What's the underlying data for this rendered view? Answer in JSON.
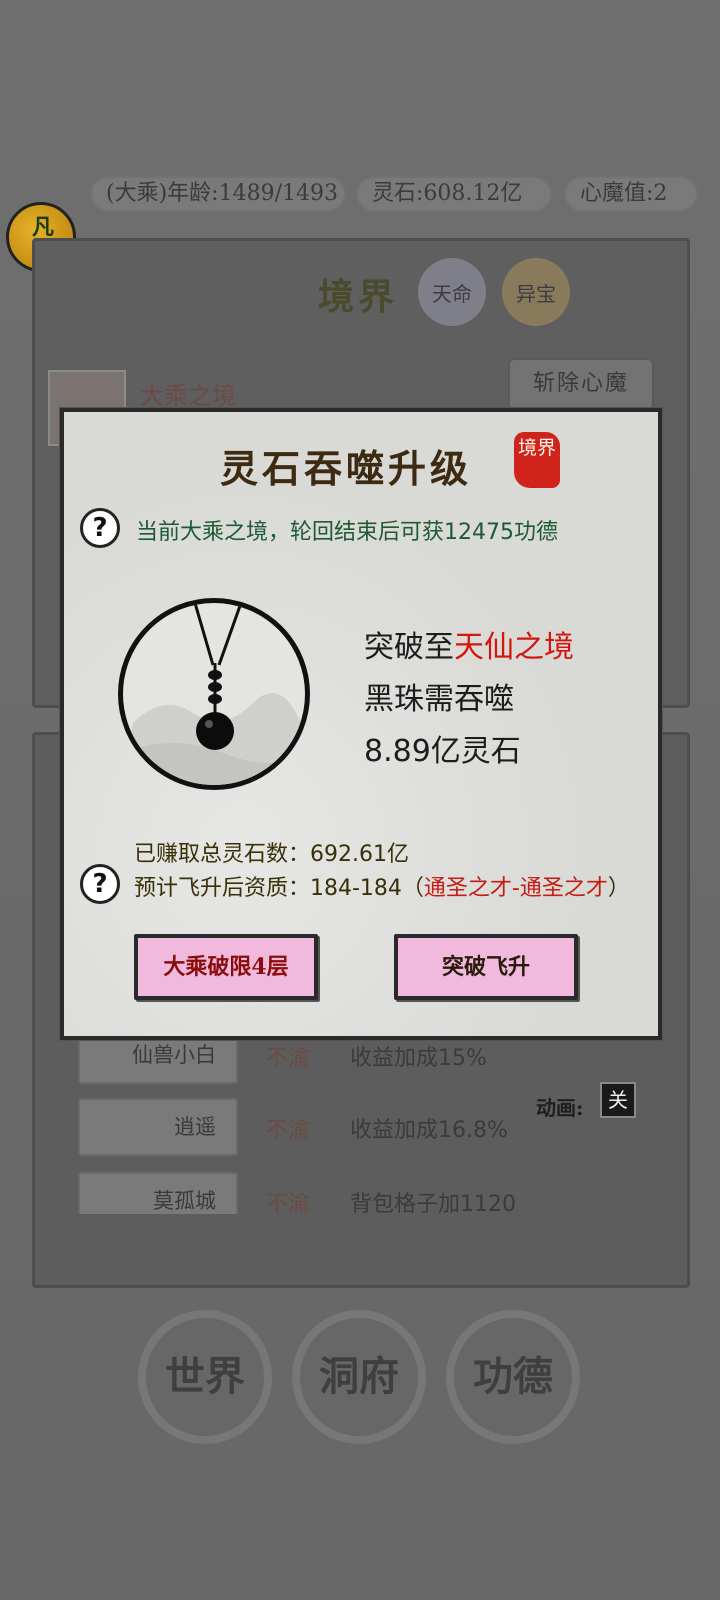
{
  "status_bar": {
    "age": "(大乘)年龄:1489/1493",
    "spirit_stone": "灵石:608.12亿",
    "heart_demon": "心魔值:2"
  },
  "fan_badge": "凡界",
  "realm_header": {
    "title": "境界",
    "tab_fate": "天命",
    "tab_treasure": "异宝"
  },
  "current_realm_name": "大乘之境",
  "kill_demon_button": "斩除心魔",
  "list": [
    {
      "name": "仙兽小白",
      "status": "不渝",
      "bonus": "收益加成15%"
    },
    {
      "name": "逍遥",
      "status": "不渝",
      "bonus": "收益加成16.8%"
    },
    {
      "name": "莫孤城",
      "status": "不渝",
      "bonus": "背包格子加1120"
    }
  ],
  "animation": {
    "label": "动画:",
    "value": "关"
  },
  "nav": {
    "world": "世界",
    "cave": "洞府",
    "merit": "功德"
  },
  "modal": {
    "title": "灵石吞噬升级",
    "seal": "境界",
    "info": "当前大乘之境，轮回结束后可获12475功德",
    "breakthrough_prefix": "突破至",
    "breakthrough_target": "天仙之境",
    "requirement_line": "黑珠需吞噬",
    "cost": "8.89亿灵石",
    "earned": "已赚取总灵石数：692.61亿",
    "predict_prefix": "预计飞升后资质：184-184（",
    "predict_grade": "通圣之才-通圣之才",
    "predict_suffix": "）",
    "btn_limit": "大乘破限4层",
    "btn_ascend": "突破飞升"
  }
}
